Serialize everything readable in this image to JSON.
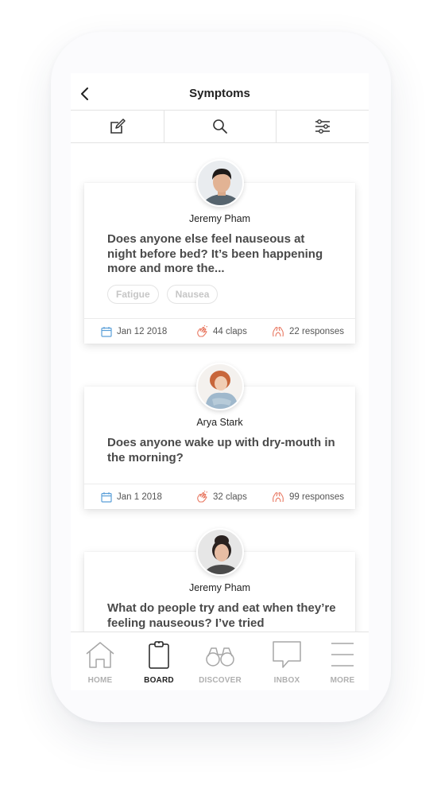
{
  "header": {
    "title": "Symptoms"
  },
  "colors": {
    "calendar": "#5a9fd8",
    "accent": "#e8765f",
    "text": "#4a4a4a"
  },
  "posts": [
    {
      "author": "Jeremy Pham",
      "question": "Does anyone else feel nauseous at night before bed? It’s been happening more and more the...",
      "tags": [
        "Fatigue",
        "Nausea"
      ],
      "date": "Jan 12 2018",
      "claps": "44 claps",
      "responses": "22 responses"
    },
    {
      "author": "Arya Stark",
      "question": "Does anyone wake up with dry-mouth in the morning?",
      "tags": [],
      "date": "Jan 1 2018",
      "claps": "32 claps",
      "responses": "99 responses"
    },
    {
      "author": "Jeremy Pham",
      "question": "What do people try and eat when they’re feeling nauseous? I’ve tried",
      "tags": [],
      "date": "",
      "claps": "",
      "responses": ""
    }
  ],
  "tabbar": {
    "items": [
      {
        "label": "HOME",
        "icon": "home-icon"
      },
      {
        "label": "BOARD",
        "icon": "clipboard-icon",
        "active": true
      },
      {
        "label": "DISCOVER",
        "icon": "binoculars-icon"
      },
      {
        "label": "INBOX",
        "icon": "chat-bubble-icon"
      },
      {
        "label": "MORE",
        "icon": "menu-icon"
      }
    ]
  }
}
